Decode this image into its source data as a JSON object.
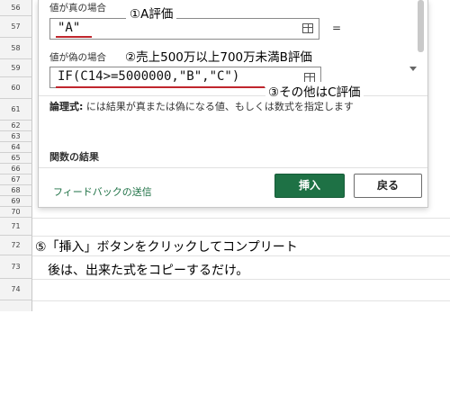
{
  "sheet": {
    "rows": [
      "56",
      "57",
      "58",
      "59",
      "60",
      "61",
      "62",
      "63",
      "64",
      "65",
      "66",
      "67",
      "68",
      "69",
      "70",
      "71",
      "72",
      "73",
      "74"
    ]
  },
  "dialog": {
    "value_if_true_label": "値が真の場合",
    "value_if_true_value": "\"A\"",
    "equals": "=",
    "value_if_false_label": "値が偽の場合",
    "value_if_false_value": "IF(C14>=5000000,\"B\",\"C\")",
    "description_bold": "論理式:",
    "description_text": " には結果が真または偽になる値、もしくは数式を指定します",
    "result_label": "関数の結果",
    "feedback_link": "フィードバックの送信",
    "insert_button": "挿入",
    "back_button": "戻る"
  },
  "annotations": {
    "a_eval": "①A評価",
    "b_eval": "②売上500万以上700万未満B評価",
    "c_eval": "③その他はC評価"
  },
  "notes": {
    "line1": "⑤「挿入」ボタンをクリックしてコンプリート",
    "line2": "後は、出来た式をコピーするだけ。"
  },
  "colors": {
    "accent_green": "#1e7145",
    "annotation_underline": "#c0262d"
  }
}
